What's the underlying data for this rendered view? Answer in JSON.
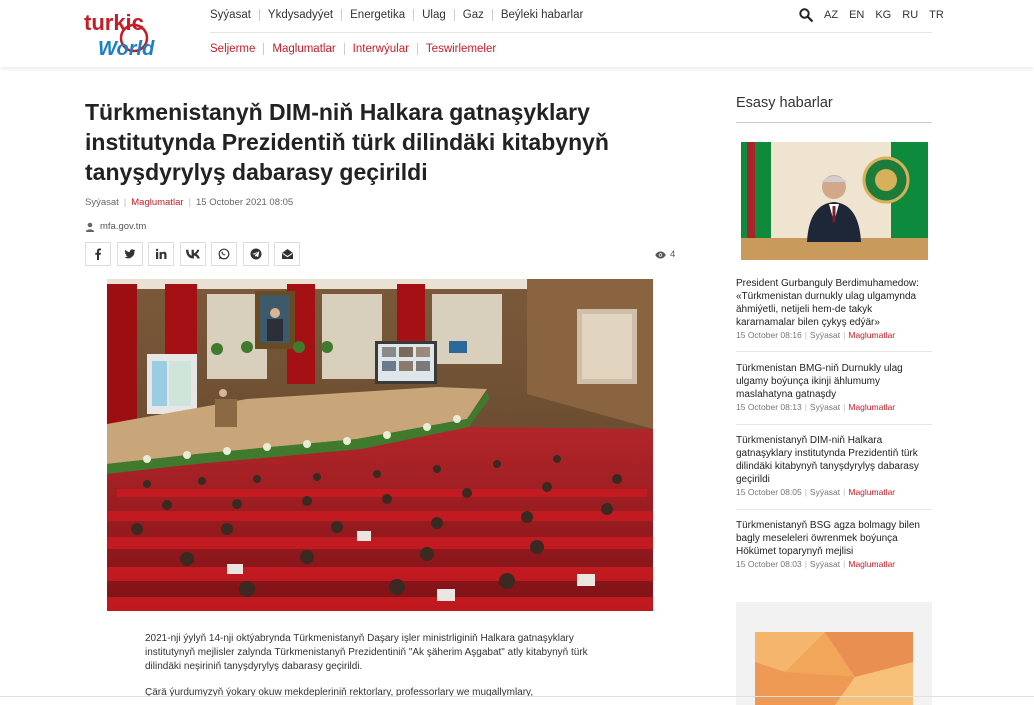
{
  "header": {
    "logo_top": "turkic",
    "logo_bottom": "World",
    "nav_primary": [
      "Syýasat",
      "Ykdysadyýet",
      "Energetika",
      "Ulag",
      "Gaz",
      "Beýleki habarlar"
    ],
    "nav_secondary": [
      "Seljerme",
      "Maglumatlar",
      "Interwýular",
      "Teswirlemeler"
    ],
    "languages": [
      "AZ",
      "EN",
      "KG",
      "RU",
      "TR"
    ]
  },
  "article": {
    "title": "Türkmenistanyň DIM-niň Halkara gatnaşyklary institutynda Prezidentiň türk dilindäki kitabynyň tanyşdyrylyş dabarasy geçirildi",
    "category1": "Syýasat",
    "category2": "Maglumatlar",
    "date": "15 October 2021 08:05",
    "source": "mfa.gov.tm",
    "views": "4",
    "paragraph1": "2021-nji ýylyň 14-nji oktýabrynda Türkmenistanyň Daşary işler ministrliginiň Halkara gatnaşyklary institutynyň mejlisler zalynda Türkmenistanyň Prezidentiniň \"Ak şäherim Aşgabat\" atly kitabynyň türk dilindäki neşiriniň tanyşdyrylyş dabarasy geçirildi.",
    "paragraph2": "Çärä ýurdumyzyň ýokary okuw mekdepleriniň rektorlary, professorlary we mugallymlary,"
  },
  "sidebar": {
    "title": "Esasy habarlar",
    "news": [
      {
        "title": "President Gurbanguly Berdimuhamedow: «Türkmenistan durnukly ulag ulgamynda ähmiýetli, netijeli hem-de takyk kararnamalar bilen çykyş edýär»",
        "date": "15 October 08:16",
        "cat1": "Syýasat",
        "cat2": "Maglumatlar"
      },
      {
        "title": "Türkmenistan BMG-niň Durnukly ulag ulgamy boýunça ikinji ählumumy maslahatyna gatnaşdy",
        "date": "15 October 08:13",
        "cat1": "Syýasat",
        "cat2": "Maglumatlar"
      },
      {
        "title": "Türkmenistanyň DIM-niň Halkara gatnaşyklary institutynda Prezidentiň türk dilindäki kitabynyň tanyşdyrylyş dabarasy geçirildi",
        "date": "15 October 08:05",
        "cat1": "Syýasat",
        "cat2": "Maglumatlar"
      },
      {
        "title": "Türkmenistanyň BSG agza bolmagy bilen bagly meseleleri öwrenmek boýunça Hökümet toparynyň mejlisi",
        "date": "15 October 08:03",
        "cat1": "Syýasat",
        "cat2": "Maglumatlar"
      }
    ]
  },
  "colors": {
    "accent": "#c41e28",
    "logo_blue": "#1a7fc4"
  }
}
